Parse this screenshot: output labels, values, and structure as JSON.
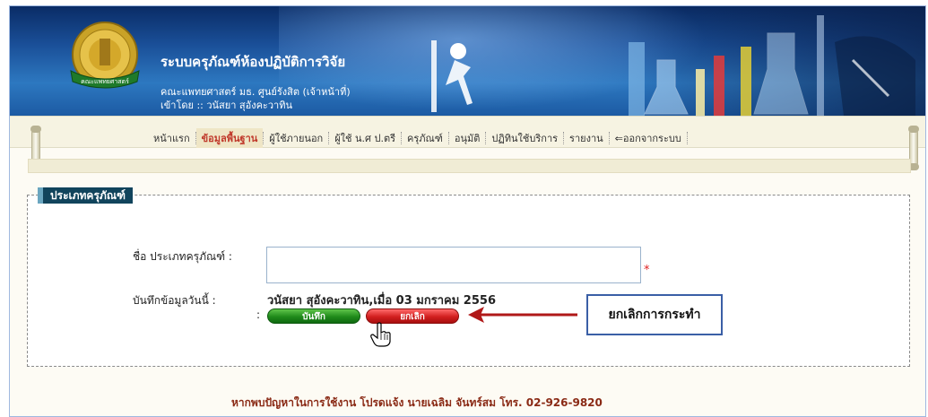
{
  "header": {
    "system_title": "ระบบครุภัณฑ์ห้องปฏิบัติการวิจัย",
    "faculty": "คณะแพทยศาสตร์ มธ. ศูนย์รังสิต (เจ้าหน้าที่)",
    "login": "เข้าโดย :: วนัสยา สุอังคะวาทิน",
    "logo_ribbon": "คณะแพทยศาสตร์"
  },
  "menu": {
    "items": [
      {
        "label": "หน้าแรก"
      },
      {
        "label": "ข้อมูลพื้นฐาน",
        "active": true
      },
      {
        "label": "ผู้ใช้ภายนอก"
      },
      {
        "label": "ผู้ใช้ น.ศ ป.ตรี"
      },
      {
        "label": "ครุภัณฑ์"
      },
      {
        "label": "อนุมัติ"
      },
      {
        "label": "ปฏิทินใช้บริการ"
      },
      {
        "label": "รายงาน"
      },
      {
        "label": "ออกจากระบบ"
      }
    ]
  },
  "form": {
    "legend": "ประเภทครุภัณฑ์",
    "type_label": "ชื่อ ประเภทครุภัณฑ์ :",
    "type_value": "",
    "required_mark": "*",
    "saved_label": "บันทึกข้อมูลวันนี้ :",
    "saved_value": "วนัสยา สุอังคะวาทิน,เมื่อ 03 มกราคม 2556",
    "colon": ":",
    "save_label": "บันทึก",
    "cancel_label": "ยกเลิก"
  },
  "annotation": {
    "text": "ยกเลิกการกระทำ"
  },
  "footer": {
    "text": "หากพบปัญหาในการใช้งาน โปรดแจ้ง นายเฉลิม จันทร์สม โทร. 02-926-9820"
  },
  "colors": {
    "accent": "#11445c",
    "save": "#1f8a1a",
    "cancel": "#d21e1e",
    "active_menu": "#c0392b"
  }
}
